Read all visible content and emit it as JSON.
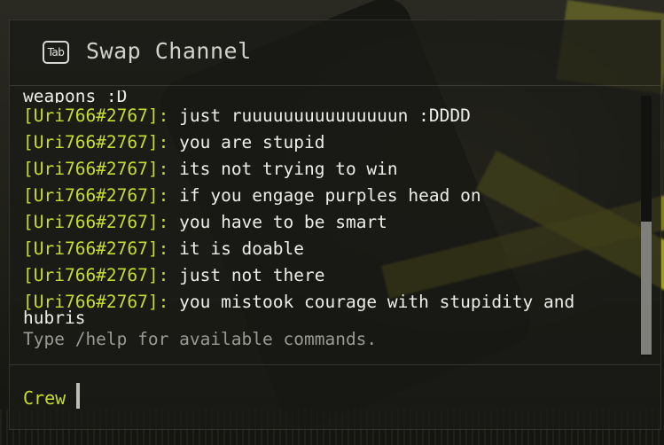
{
  "header": {
    "tab_key": "Tab",
    "title": "Swap Channel"
  },
  "chat": {
    "partial_line": "weapons :D",
    "messages": [
      {
        "sender": "[Uri766#2767]:",
        "text": " just ruuuuuuuuuuuuuuun :DDDD"
      },
      {
        "sender": "[Uri766#2767]:",
        "text": " you are stupid"
      },
      {
        "sender": "[Uri766#2767]:",
        "text": " its not trying to win"
      },
      {
        "sender": "[Uri766#2767]:",
        "text": " if you engage purples head on"
      },
      {
        "sender": "[Uri766#2767]:",
        "text": " you have to be smart"
      },
      {
        "sender": "[Uri766#2767]:",
        "text": " it is doable"
      },
      {
        "sender": "[Uri766#2767]:",
        "text": " just not there"
      },
      {
        "sender": "[Uri766#2767]:",
        "text": " you mistook courage with stupidity and hubris"
      }
    ],
    "hint": "Type /help for available commands."
  },
  "input": {
    "channel": "Crew",
    "value": ""
  },
  "colors": {
    "sender": "#c6dd2f",
    "text": "#ececea",
    "hint": "#9a9a94"
  }
}
